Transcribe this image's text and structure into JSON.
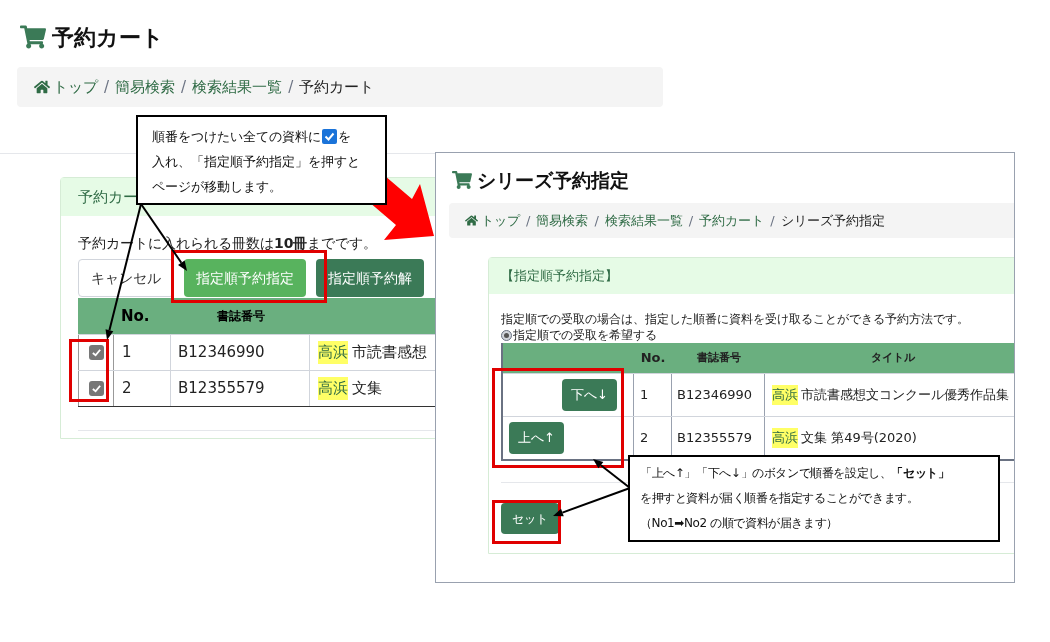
{
  "cart_page": {
    "title": "予約カート",
    "breadcrumb": [
      {
        "label": "トップ",
        "current": false,
        "home": true
      },
      {
        "separator": "/"
      },
      {
        "label": "簡易検索",
        "current": false,
        "home": false
      },
      {
        "separator": "/"
      },
      {
        "label": "検索結果一覧",
        "current": false,
        "home": false
      },
      {
        "separator": "/"
      },
      {
        "label": "予約カート",
        "current": true,
        "home": false
      }
    ],
    "card": {
      "header": "予約カー",
      "notice": "予約カートに入れられる冊数は**10冊**までです。",
      "buttons": [
        {
          "label": "キャンセル",
          "kind": "outline"
        },
        {
          "label": "指定順予約指定",
          "kind": "primary"
        },
        {
          "label": "指定順予約解",
          "kind": "dark"
        }
      ],
      "table": {
        "columns": [
          "No.",
          "書誌番号"
        ],
        "rows": [
          {
            "checked": true,
            "no": "1",
            "id": "B12346990",
            "tag": "高浜",
            "title": "市読書感想"
          },
          {
            "checked": true,
            "no": "2",
            "id": "B12355579",
            "tag": "高浜",
            "title": "文集"
          }
        ]
      }
    }
  },
  "series_page": {
    "title": "シリーズ予約指定",
    "breadcrumb": [
      {
        "label": "トップ",
        "current": false,
        "home": true
      },
      {
        "separator": "/"
      },
      {
        "label": "簡易検索",
        "current": false,
        "home": false
      },
      {
        "separator": "/"
      },
      {
        "label": "検索結果一覧",
        "current": false,
        "home": false
      },
      {
        "separator": "/"
      },
      {
        "label": "予約カート",
        "current": false,
        "home": false
      },
      {
        "separator": "/"
      },
      {
        "label": "シリーズ予約指定",
        "current": true,
        "home": false
      }
    ],
    "card": {
      "header": "【指定順予約指定】",
      "description": "指定順での受取の場合は、指定した順番に資料を受け取ることができる予約方法です。",
      "radio": {
        "label": "指定順での受取を希望する",
        "selected": true
      },
      "table": {
        "columns": [
          "No.",
          "書誌番号",
          "タイトル"
        ],
        "rows": [
          {
            "move_button": {
              "label": "下へ↓",
              "kind": "down"
            },
            "no": "1",
            "id": "B12346990",
            "tag": "高浜",
            "title": "市読書感想文コンクール優秀作品集"
          },
          {
            "move_button": {
              "label": "上へ↑",
              "kind": "up"
            },
            "no": "2",
            "id": "B12355579",
            "tag": "高浜",
            "title": "文集 第49号(2020)"
          }
        ]
      },
      "set_button": "セット"
    }
  },
  "callouts": [
    {
      "before_icon": "順番をつけたい全ての資料に",
      "after_icon": "を",
      "lines": [
        "入れ、「指定順予約指定」を押すと",
        "ページが移動します。"
      ]
    },
    {
      "lines": [
        "「上へ↑」「下へ↓」のボタンで順番を設定し、**「セット」**",
        "を押すと資料が届く順番を指定することができます。",
        "（No1➡No2 の順で資料が届きます）"
      ]
    }
  ]
}
